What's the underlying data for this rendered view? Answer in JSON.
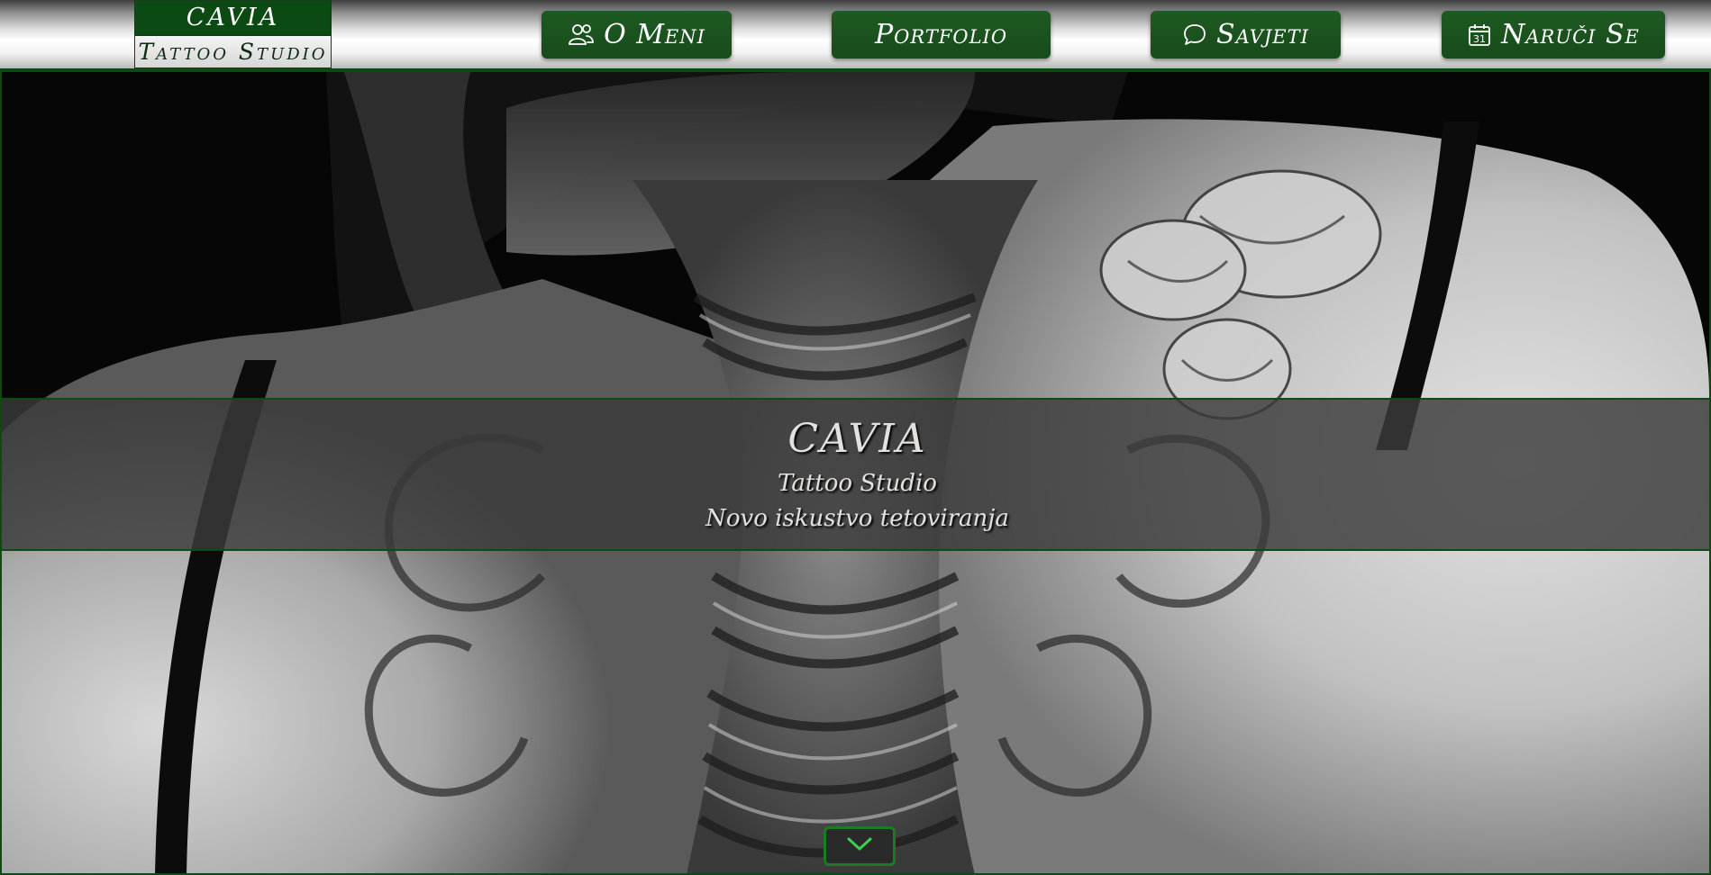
{
  "logo": {
    "top_text": "CAVIA",
    "bottom_text": "Tattoo Studio"
  },
  "nav": {
    "items": [
      {
        "label": "O Meni",
        "icon": "people-icon"
      },
      {
        "label": "Portfolio",
        "icon": ""
      },
      {
        "label": "Savjeti",
        "icon": "chat-bubble-icon"
      },
      {
        "label": "Naruči Se",
        "icon": "calendar-icon"
      }
    ]
  },
  "hero": {
    "image": "black-and-white photo of a back tattoo",
    "title": "CAVIA",
    "subtitle": "Tattoo Studio",
    "tagline": "Novo iskustvo tetoviranja",
    "scroll_icon": "chevron-down-icon"
  },
  "calendar_icon_number": "31",
  "colors": {
    "brand_green": "#1b5220",
    "border_green": "#0d4a14",
    "accent_green": "#1c7a26",
    "banner_text": "#e4e0de"
  }
}
